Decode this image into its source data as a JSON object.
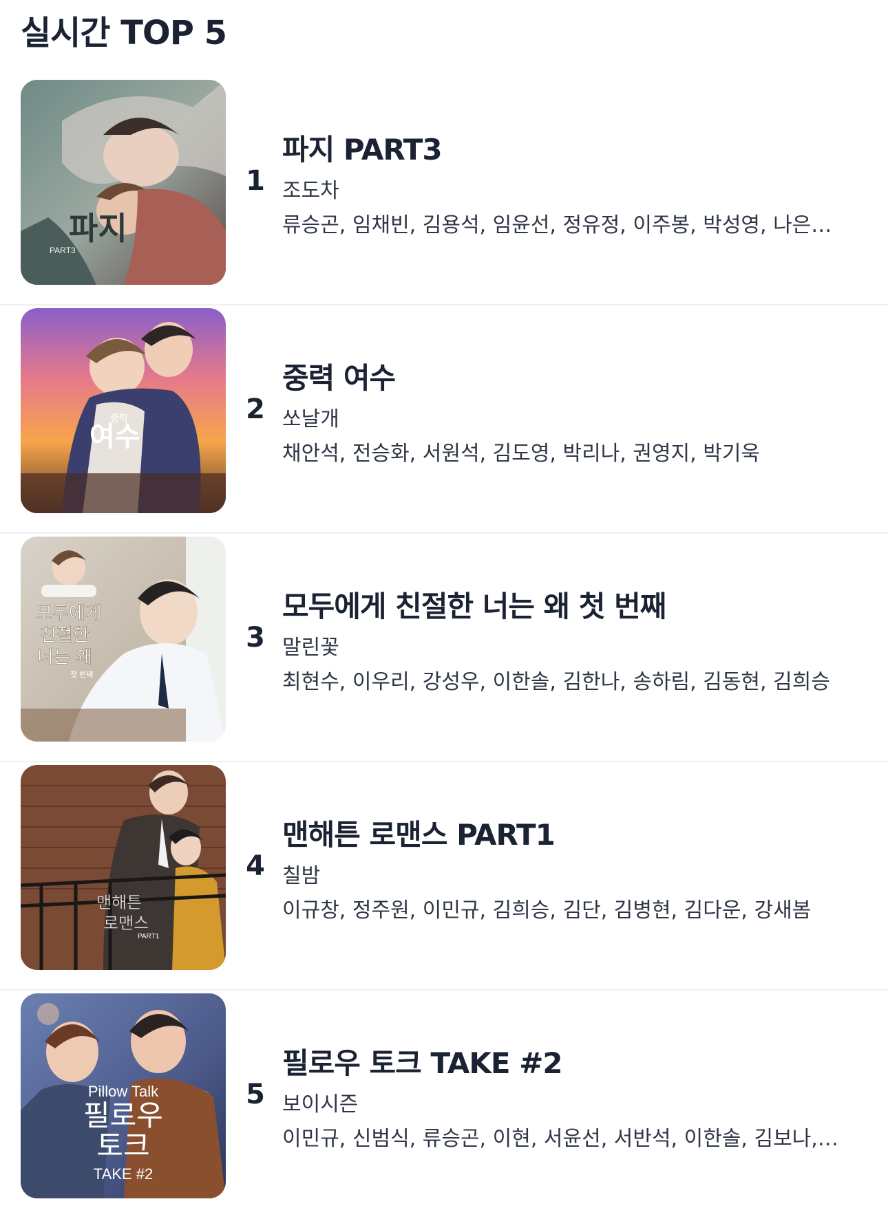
{
  "header": {
    "title": "실시간 TOP 5"
  },
  "items": [
    {
      "rank": "1",
      "title": "파지 PART3",
      "author": "조도차",
      "cast": "류승곤, 임채빈, 김용석, 임윤선, 정유정, 이주봉, 박성영, 나은…",
      "cover": {
        "main": "파지",
        "sub": "PART3"
      }
    },
    {
      "rank": "2",
      "title": "중력 여수",
      "author": "쏘날개",
      "cast": "채안석, 전승화, 서원석, 김도영, 박리나, 권영지, 박기욱",
      "cover": {
        "main": "여수",
        "sub": "중력"
      }
    },
    {
      "rank": "3",
      "title": "모두에게 친절한 너는 왜 첫 번째",
      "author": "말린꽃",
      "cast": "최현수, 이우리, 강성우, 이한솔, 김한나, 송하림, 김동현, 김희승",
      "cover": {
        "line1": "모두에게",
        "line2": "친절한",
        "line3": "너는 왜",
        "sub": "첫 번째"
      }
    },
    {
      "rank": "4",
      "title": "맨해튼 로맨스 PART1",
      "author": "칠밤",
      "cast": "이규창, 정주원, 이민규, 김희승, 김단, 김병현, 김다운, 강새봄",
      "cover": {
        "line1": "맨해튼",
        "line2": "로맨스",
        "sub": "PART1"
      }
    },
    {
      "rank": "5",
      "title": "필로우 토크 TAKE #2",
      "author": "보이시즌",
      "cast": "이민규, 신범식, 류승곤, 이현, 서윤선, 서반석, 이한솔, 김보나,…",
      "cover": {
        "eng": "Pillow Talk",
        "line1": "필로우",
        "line2": "토크",
        "sub": "TAKE #2"
      }
    }
  ]
}
